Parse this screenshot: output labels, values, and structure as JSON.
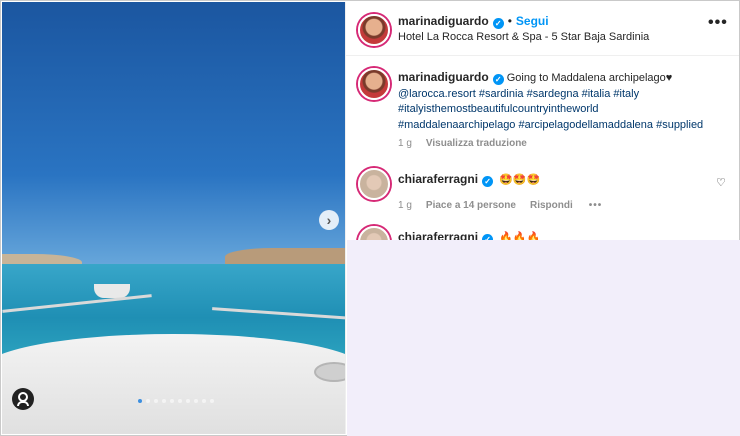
{
  "post": {
    "username": "marinadiguardo",
    "separator": "•",
    "follow_label": "Segui",
    "location": "Hotel La Rocca Resort & Spa - 5 Star Baja Sardinia",
    "more_icon": "more-horizontal-icon"
  },
  "caption": {
    "username": "marinadiguardo",
    "text": "Going to Maddalena archipelago♥",
    "mention": "@larocca.resort",
    "tags_line1": "#sardinia #sardegna #italia #italy",
    "tags_line2": "#italyisthemostbeautifulcountryintheworld",
    "tags_line3": "#maddalenaarchipelago #arcipelagodellamaddalena #supplied",
    "age": "1 g",
    "translate_label": "Visualizza traduzione"
  },
  "comments": [
    {
      "username": "chiaraferragni",
      "emoji": "🤩🤩🤩",
      "age": "1 g",
      "likes": "Piace a 14 persone",
      "reply_label": "Rispondi",
      "more": "•••"
    },
    {
      "username": "chiaraferragni",
      "emoji": "🔥🔥🔥"
    }
  ],
  "media": {
    "next_icon": "chevron-right-icon",
    "next_glyph": "›",
    "tag_icon": "user-tag-icon",
    "carousel_count": 10,
    "carousel_active": 1
  },
  "colors": {
    "accent": "#0095f6",
    "link": "#00376b",
    "muted": "#8e8e8e",
    "overlay": "#f2eefa"
  }
}
